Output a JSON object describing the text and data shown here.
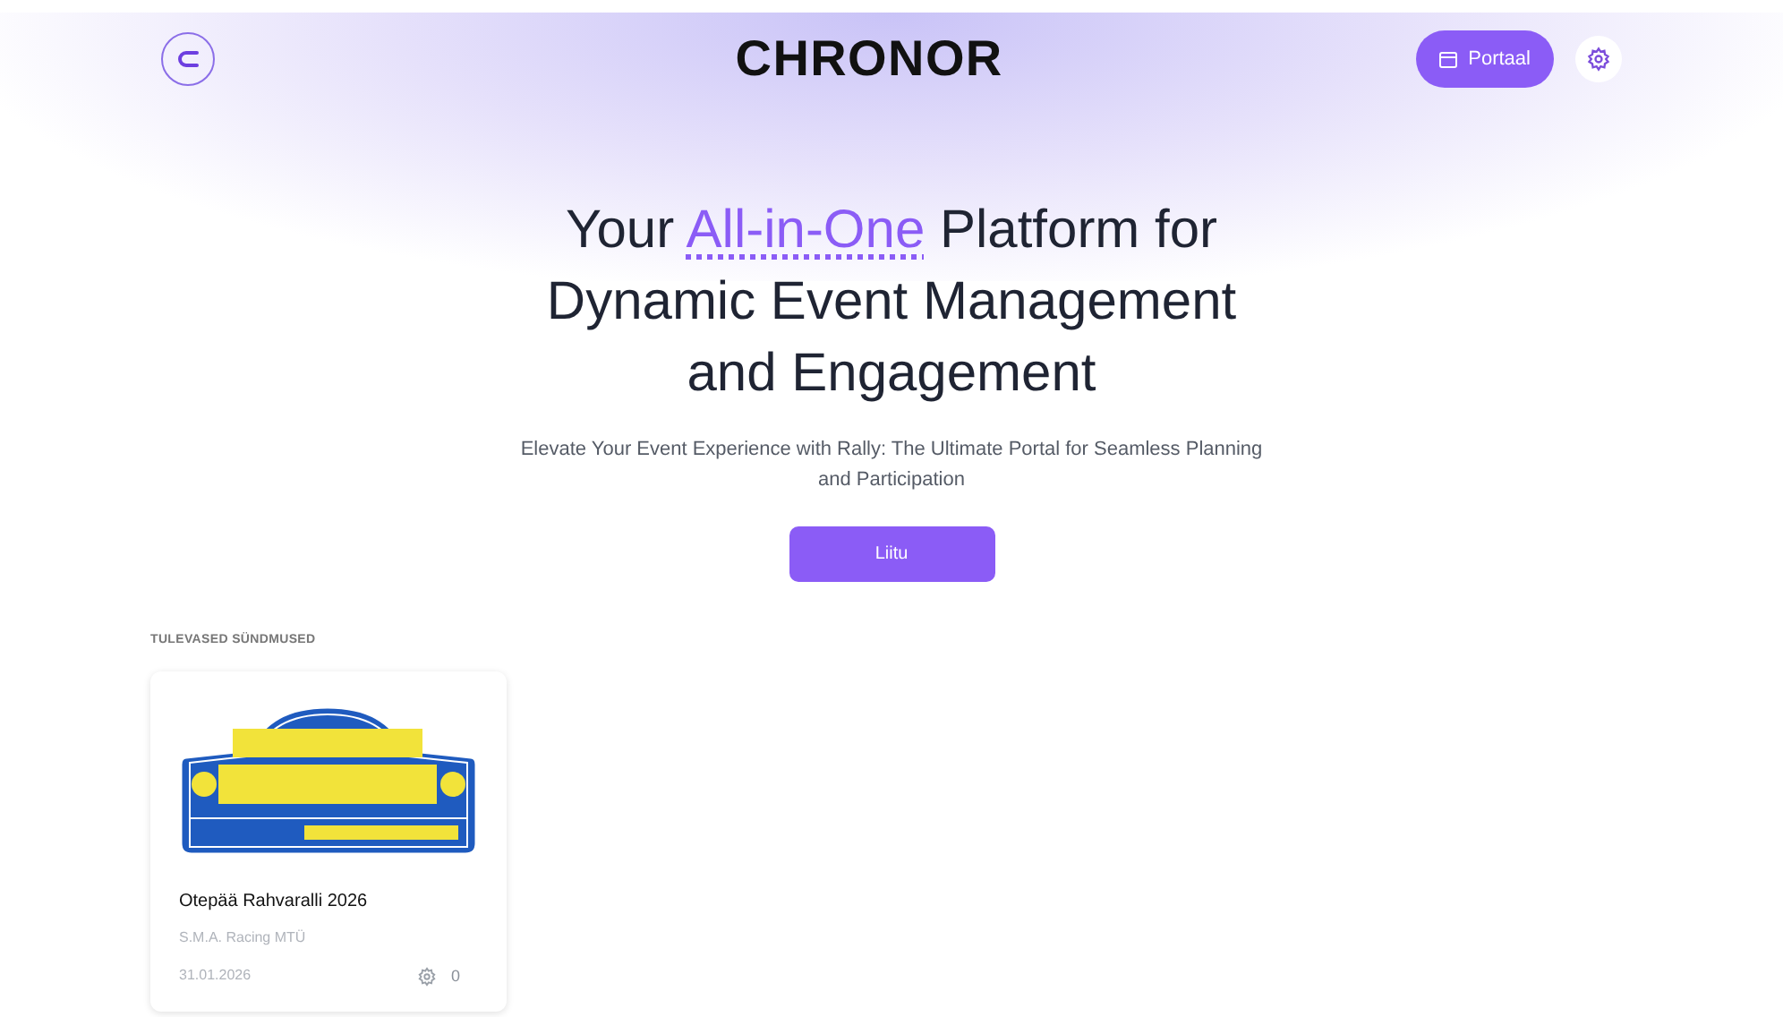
{
  "header": {
    "brand": "CHRONOR",
    "portal_button": "Portaal"
  },
  "hero": {
    "title_before": "Your ",
    "title_highlight": "All-in-One",
    "title_after": " Platform for Dynamic Event Management and Engagement",
    "subtitle": "Elevate Your Event Experience with Rally: The Ultimate Portal for Seamless Planning and Participation",
    "cta": "Liitu"
  },
  "events_section": {
    "heading": "TULEVASED SÜNDMUSED",
    "events": [
      {
        "title": "Otepää Rahvaralli 2026",
        "organizer": "S.M.A. Racing MTÜ",
        "date": "31.01.2026",
        "participants": "0"
      }
    ]
  }
}
